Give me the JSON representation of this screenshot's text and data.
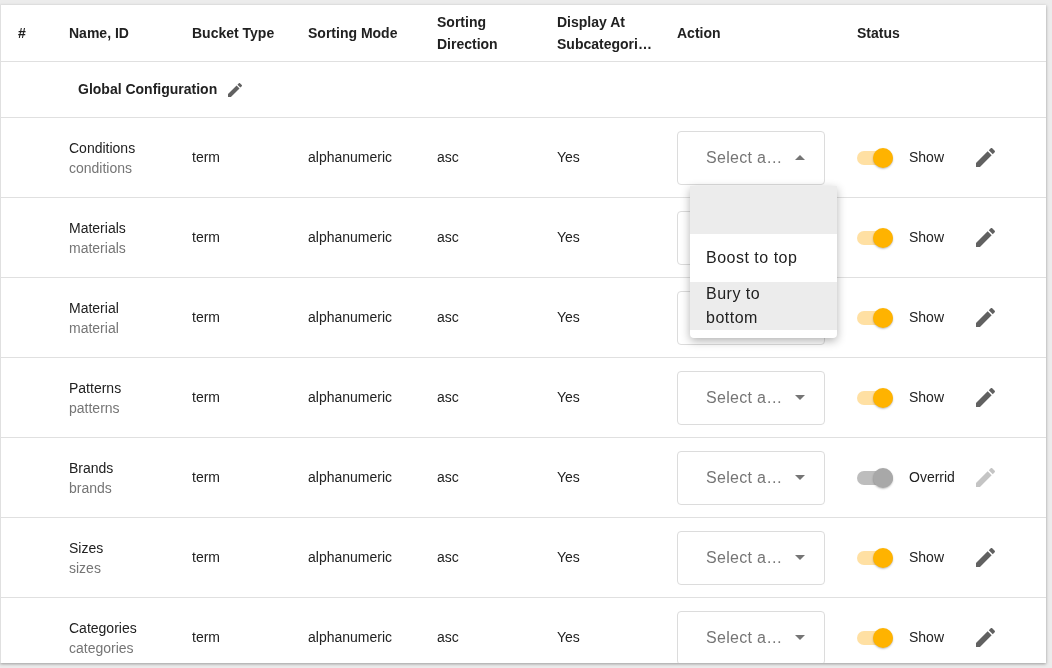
{
  "table": {
    "columns": [
      "#",
      "Name, ID",
      "Bucket Type",
      "Sorting Mode",
      "Sorting Direction",
      "Display At Subcategori…",
      "Action",
      "Status"
    ],
    "group_row": {
      "label": "Global Configuration"
    },
    "rows": [
      {
        "name": "Conditions",
        "id": "conditions",
        "bucket_type": "term",
        "sorting_mode": "alphanumeric",
        "sorting_direction": "asc",
        "display_at_subcategories": "Yes",
        "action": {
          "placeholder": "Select a…",
          "expanded": true,
          "options": [
            {
              "kind": "blank",
              "highlighted": true
            },
            {
              "kind": "text",
              "label": "Boost to top",
              "highlighted": false
            },
            {
              "kind": "text",
              "label": "Bury to bottom",
              "highlighted": true
            }
          ]
        },
        "status": {
          "on": true,
          "disabled": false,
          "label": "Show"
        }
      },
      {
        "name": "Materials",
        "id": "materials",
        "bucket_type": "term",
        "sorting_mode": "alphanumeric",
        "sorting_direction": "asc",
        "display_at_subcategories": "Yes",
        "status": {
          "on": true,
          "disabled": false,
          "label": "Show"
        }
      },
      {
        "name": "Material",
        "id": "material",
        "bucket_type": "term",
        "sorting_mode": "alphanumeric",
        "sorting_direction": "asc",
        "display_at_subcategories": "Yes",
        "status": {
          "on": true,
          "disabled": false,
          "label": "Show"
        }
      },
      {
        "name": "Patterns",
        "id": "patterns",
        "bucket_type": "term",
        "sorting_mode": "alphanumeric",
        "sorting_direction": "asc",
        "display_at_subcategories": "Yes",
        "action": {
          "placeholder": "Select a…",
          "expanded": false
        },
        "status": {
          "on": true,
          "disabled": false,
          "label": "Show"
        }
      },
      {
        "name": "Brands",
        "id": "brands",
        "bucket_type": "term",
        "sorting_mode": "alphanumeric",
        "sorting_direction": "asc",
        "display_at_subcategories": "Yes",
        "action": {
          "placeholder": "Select a…",
          "expanded": false
        },
        "status": {
          "on": true,
          "disabled": true,
          "label": "Overrid"
        }
      },
      {
        "name": "Sizes",
        "id": "sizes",
        "bucket_type": "term",
        "sorting_mode": "alphanumeric",
        "sorting_direction": "asc",
        "display_at_subcategories": "Yes",
        "action": {
          "placeholder": "Select a…",
          "expanded": false
        },
        "status": {
          "on": true,
          "disabled": false,
          "label": "Show"
        }
      },
      {
        "name": "Categories",
        "id": "categories",
        "bucket_type": "term",
        "sorting_mode": "alphanumeric",
        "sorting_direction": "asc",
        "display_at_subcategories": "Yes",
        "action": {
          "placeholder": "Select a…",
          "expanded": false
        },
        "status": {
          "on": true,
          "disabled": false,
          "label": "Show"
        }
      }
    ]
  }
}
